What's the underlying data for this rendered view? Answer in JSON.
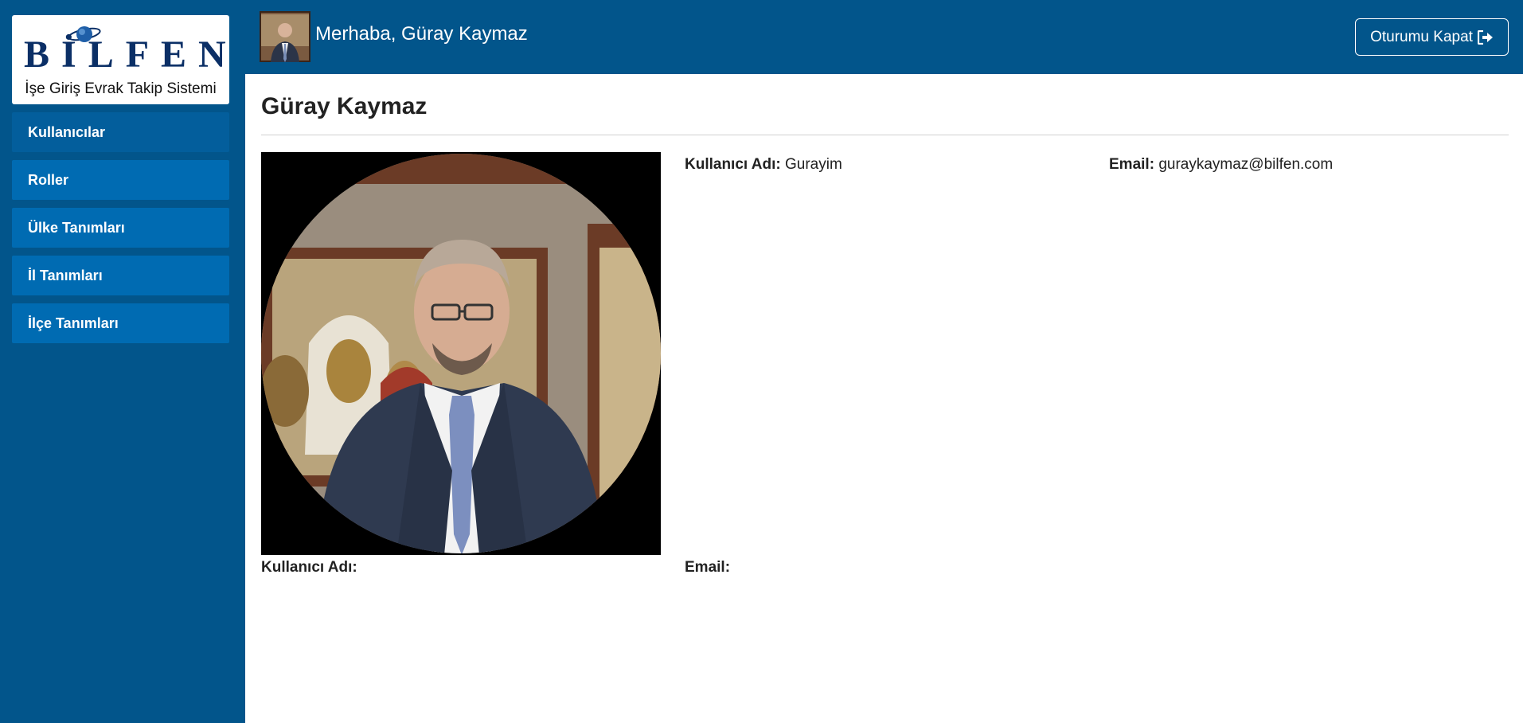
{
  "brand": {
    "logo_text": "BİLFEN",
    "subtitle": "İşe Giriş Evrak Takip Sistemi"
  },
  "sidebar": {
    "items": [
      {
        "label": "Kullanıcılar"
      },
      {
        "label": "Roller"
      },
      {
        "label": "Ülke Tanımları"
      },
      {
        "label": "İl Tanımları"
      },
      {
        "label": "İlçe Tanımları"
      }
    ]
  },
  "header": {
    "greeting": "Merhaba, Güray Kaymaz",
    "logout_label": "Oturumu Kapat",
    "logout_icon": "sign-out-icon"
  },
  "profile": {
    "title": "Güray Kaymaz",
    "username_label": "Kullanıcı Adı:",
    "username_value": "Gurayim",
    "email_label": "Email:",
    "email_value": "guraykaymaz@bilfen.com"
  },
  "lower_fields": {
    "username_label": "Kullanıcı Adı:",
    "email_label": "Email:"
  },
  "colors": {
    "primary": "#02558b",
    "menu_item": "#006bb2",
    "logo_text": "#0b2f66"
  }
}
